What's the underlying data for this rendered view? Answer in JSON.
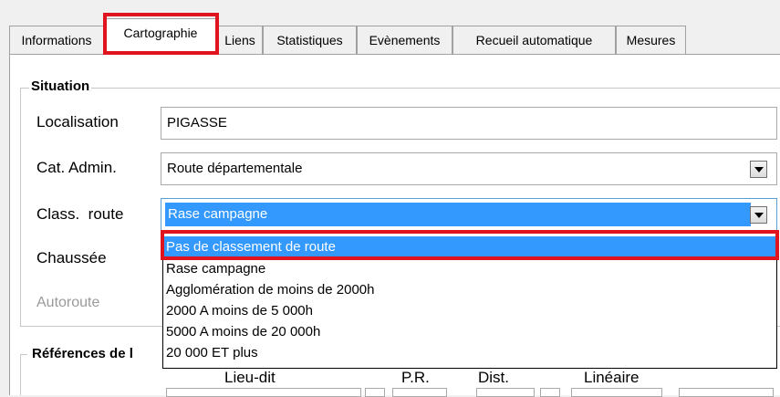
{
  "tabs": [
    {
      "label": "Informations"
    },
    {
      "label": "Cartographie"
    },
    {
      "label": "Liens"
    },
    {
      "label": "Statistiques"
    },
    {
      "label": "Evènements"
    },
    {
      "label": "Recueil automatique"
    },
    {
      "label": "Mesures"
    }
  ],
  "active_tab": "Cartographie",
  "situation": {
    "title": "Situation",
    "localisation": {
      "label": "Localisation",
      "value": "PIGASSE"
    },
    "cat_admin": {
      "label": "Cat. Admin.",
      "value": "Route départementale"
    },
    "class_route": {
      "label": "Class.  route",
      "value": "Rase campagne"
    },
    "chaussee": {
      "label": "Chaussée"
    },
    "autoroute": {
      "label": "Autoroute"
    }
  },
  "dropdown": {
    "options": [
      "Pas de classement de route",
      "Rase campagne",
      "Agglomération de moins de 2000h",
      "2000 A moins de 5 000h",
      "5000 A moins de 20 000h",
      "20 000 ET plus"
    ],
    "highlighted_index": 0
  },
  "references": {
    "title": "Références de l",
    "columns": {
      "lieu_dit": "Lieu-dit",
      "pr": "P.R.",
      "dist": "Dist.",
      "lineaire": "Linéaire"
    }
  },
  "colors": {
    "highlight": "#e0141e",
    "selection": "#3399ff"
  }
}
